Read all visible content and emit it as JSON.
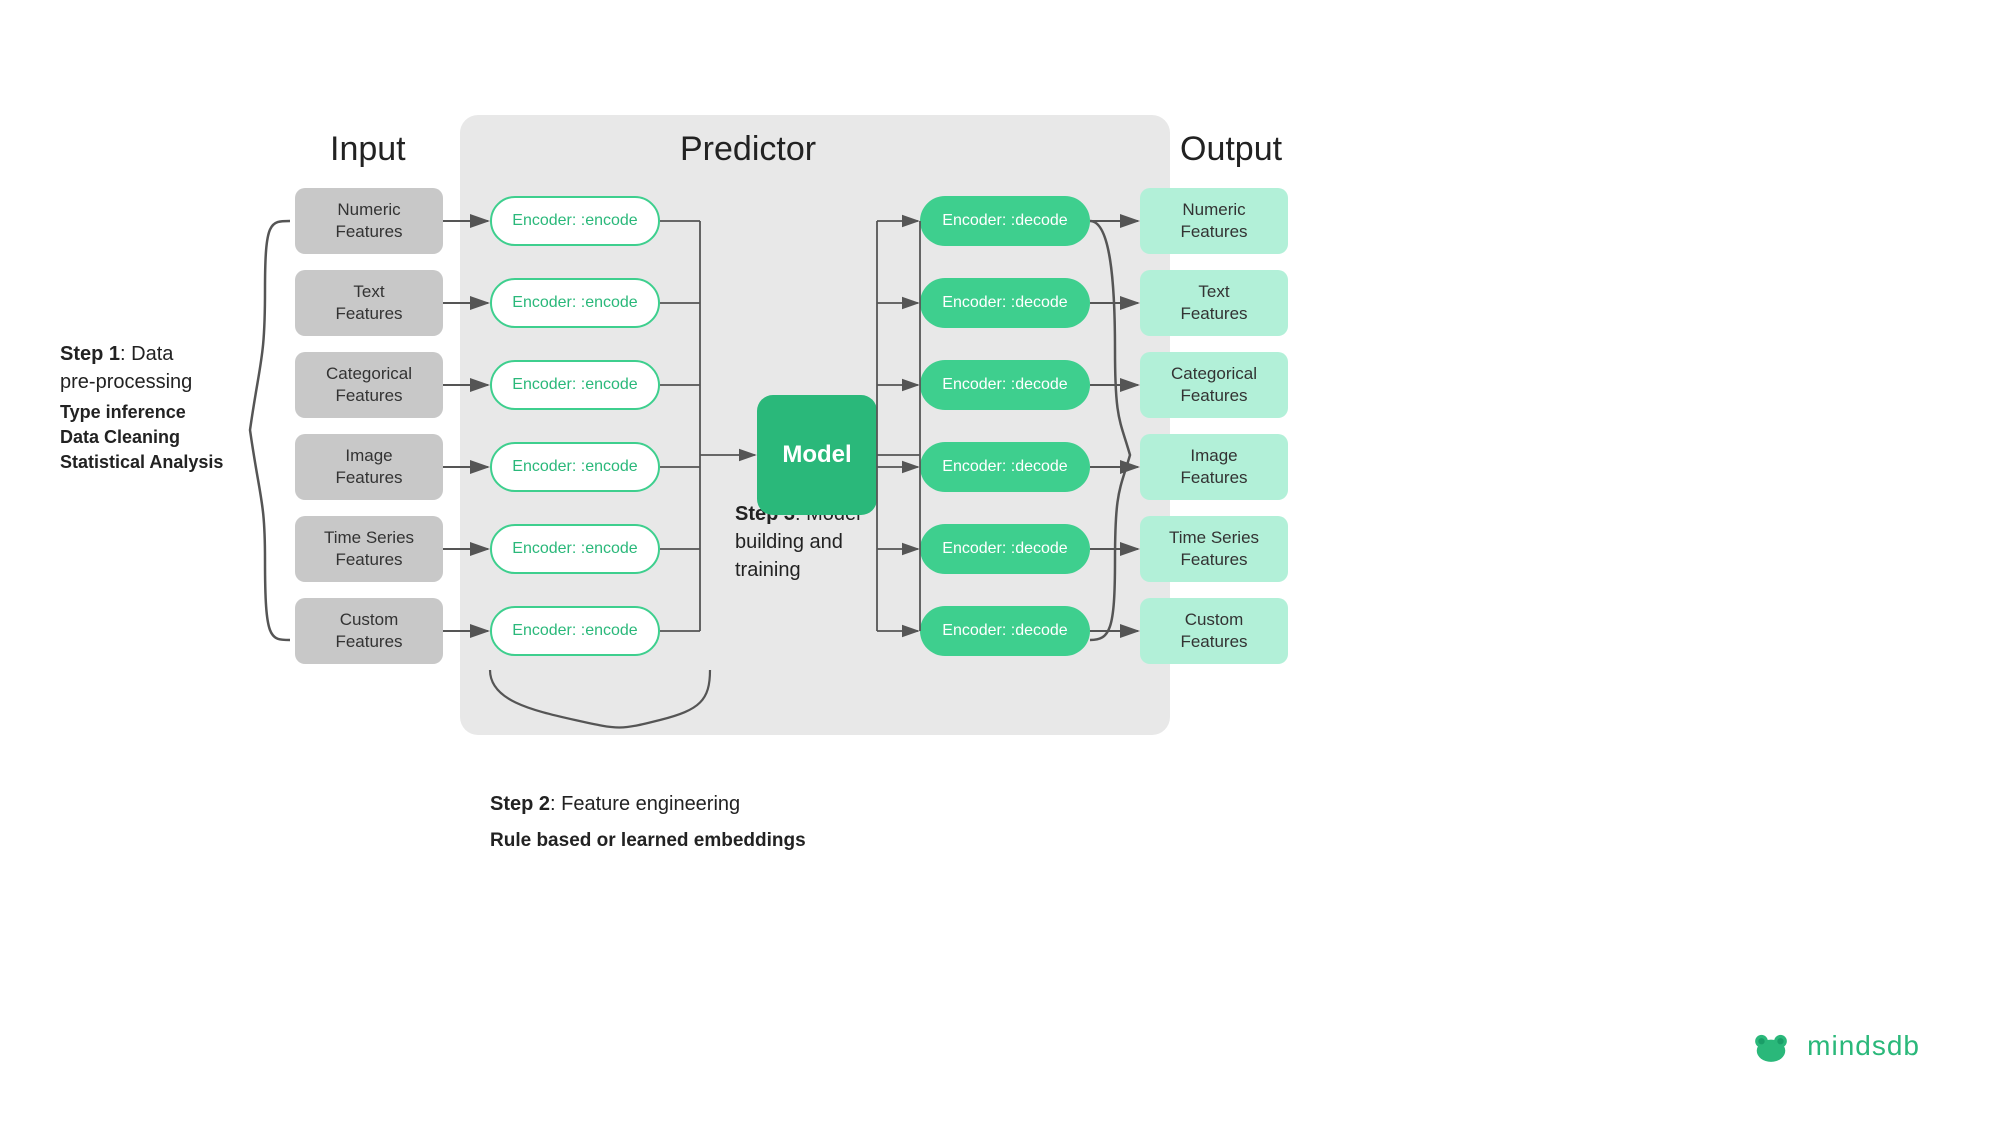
{
  "titles": {
    "input": "Input",
    "predictor": "Predictor",
    "output": "Output"
  },
  "steps": {
    "step1": "Step 1",
    "step1_label": ": Data\npre-processing",
    "step1_sub": "Type inference\nData Cleaning\nStatistical Analysis",
    "step2": "Step 2",
    "step2_label": ": Feature engineering",
    "step2_sub": "Rule based or learned embeddings",
    "step3": "Step 3",
    "step3_label": ": Model\nbuilding and\ntraining"
  },
  "input_boxes": [
    {
      "id": "numeric",
      "label": "Numeric\nFeatures"
    },
    {
      "id": "text",
      "label": "Text\nFeatures"
    },
    {
      "id": "categorical",
      "label": "Categorical\nFeatures"
    },
    {
      "id": "image",
      "label": "Image\nFeatures"
    },
    {
      "id": "timeseries",
      "label": "Time Series\nFeatures"
    },
    {
      "id": "custom",
      "label": "Custom\nFeatures"
    }
  ],
  "output_boxes": [
    {
      "id": "numeric",
      "label": "Numeric\nFeatures"
    },
    {
      "id": "text",
      "label": "Text\nFeatures"
    },
    {
      "id": "categorical",
      "label": "Categorical\nFeatures"
    },
    {
      "id": "image",
      "label": "Image\nFeatures"
    },
    {
      "id": "timeseries",
      "label": "Time Series\nFeatures"
    },
    {
      "id": "custom",
      "label": "Custom\nFeatures"
    }
  ],
  "encoder_label": "Encoder: :encode",
  "decoder_label": "Encoder: :decode",
  "model_label": "Model",
  "logo": {
    "text": "mindsdb",
    "color": "#2ab87a"
  },
  "colors": {
    "green": "#2ab87a",
    "light_green": "#b2f0d8",
    "gray_bg": "#e8e8e8",
    "input_gray": "#c8c8c8",
    "encoder_border": "#3ecf8e"
  }
}
